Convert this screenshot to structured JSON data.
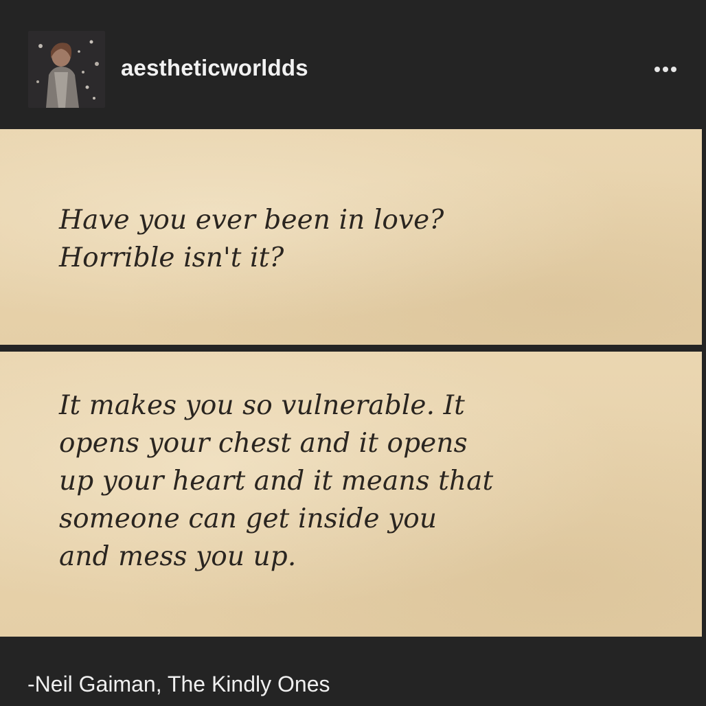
{
  "post": {
    "username": "aestheticworldds",
    "avatar_icon": "profile-photo",
    "more_icon": "ellipsis-icon",
    "quote_part_1": "Have you ever been in love?\nHorrible isn't it?",
    "quote_part_2": "It makes you so vulnerable. It\nopens your chest and it opens\nup your heart and it means that\nsomeone can get inside you\nand mess you up.",
    "attribution": "-Neil Gaiman, The Kindly Ones"
  },
  "colors": {
    "background": "#242424",
    "paper": "#e7d2ac",
    "ink": "#2a2520",
    "header_text": "#f2f2f2"
  }
}
